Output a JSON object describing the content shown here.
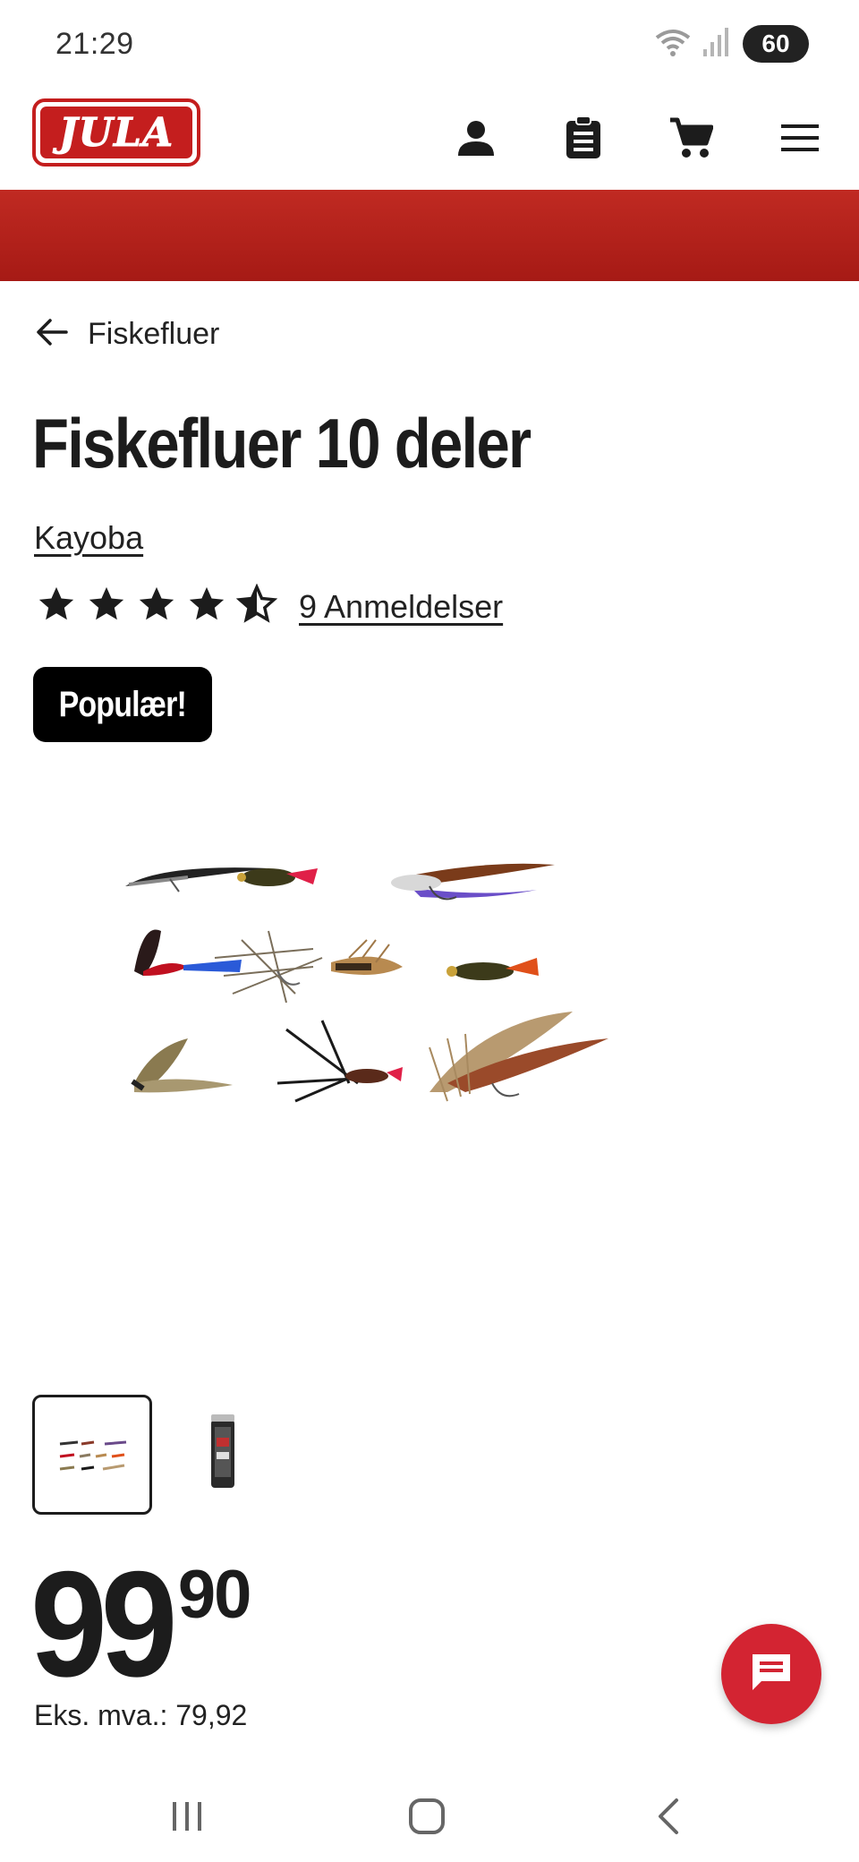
{
  "status": {
    "time": "21:29",
    "battery": "60"
  },
  "header": {
    "logo_text": "JULA",
    "icons": [
      "account-icon",
      "order-list-icon",
      "cart-icon",
      "menu-icon"
    ]
  },
  "breadcrumb": {
    "label": "Fiskefluer"
  },
  "product": {
    "title": "Fiskefluer 10 deler",
    "brand": "Kayoba",
    "rating": 4.5,
    "reviews": "9 Anmeldelser",
    "badge": "Populær!",
    "price_main": "99",
    "price_decimals": "90",
    "vat_line": "Eks. mva.: 79,92"
  },
  "colors": {
    "brand_red": "#c41e1e",
    "banner_red": "#b0201a",
    "chat_red": "#d32432"
  }
}
